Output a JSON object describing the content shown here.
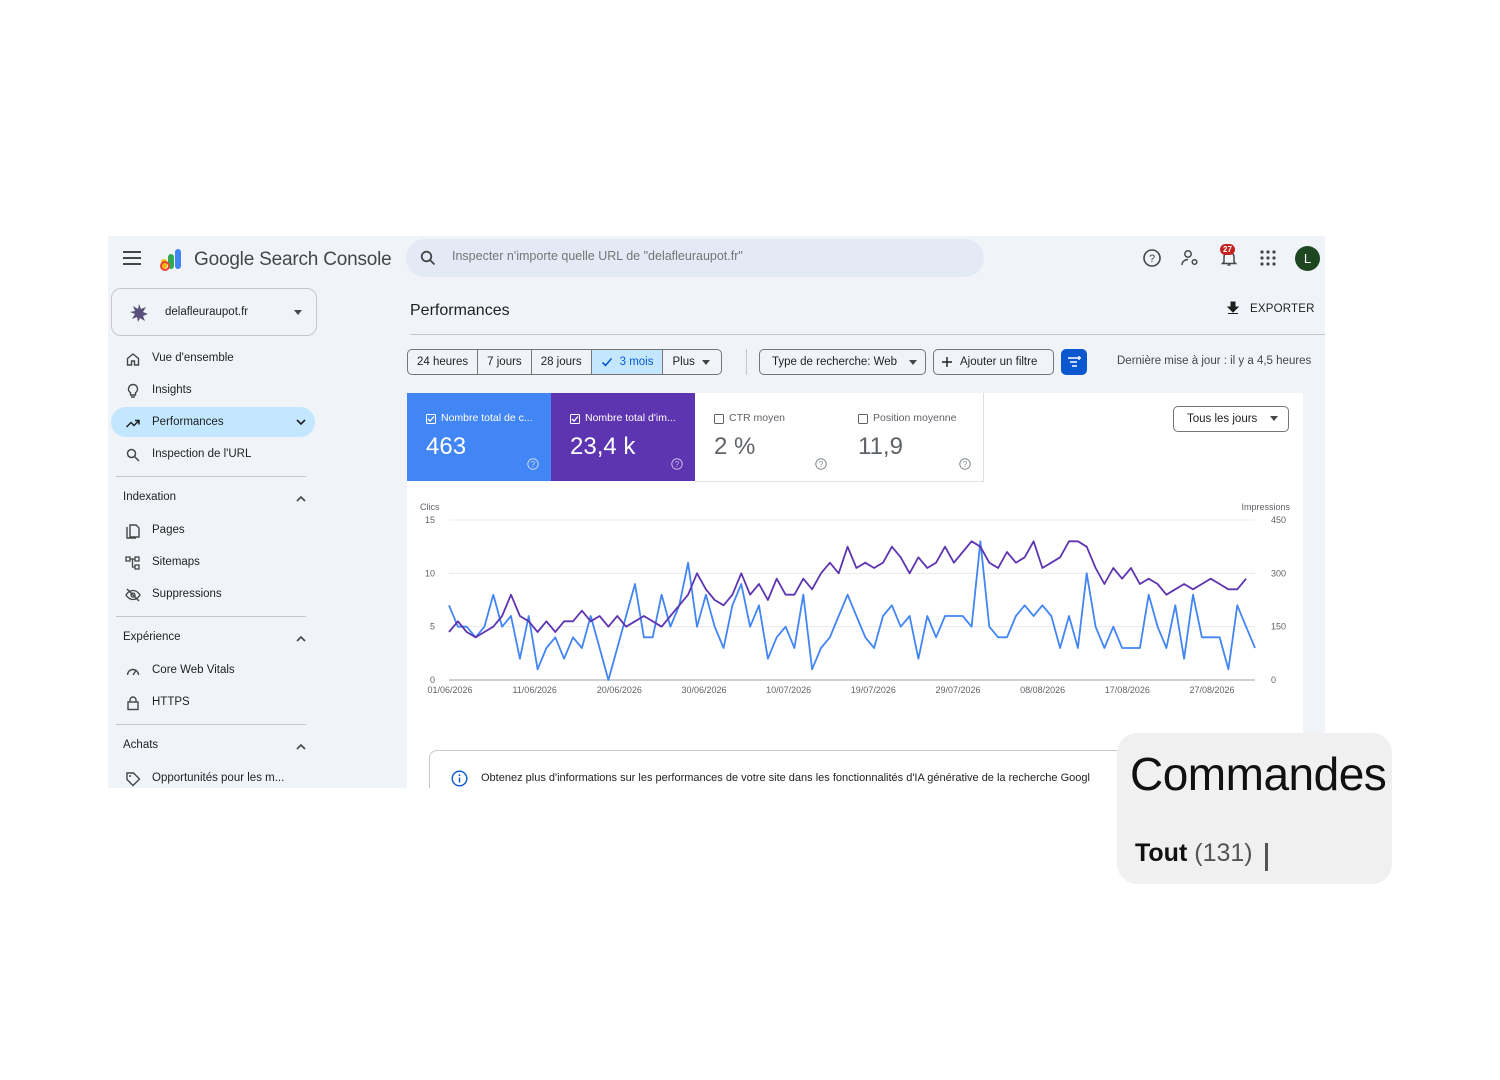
{
  "header": {
    "app_title": "Google Search Console",
    "search_placeholder": "Inspecter n'importe quelle URL de \"delafleuraupot.fr\"",
    "notification_count": "27",
    "avatar_letter": "L"
  },
  "property": {
    "name": "delafleuraupot.fr"
  },
  "sidebar": {
    "items": [
      {
        "label": "Vue d'ensemble",
        "icon": "home-icon"
      },
      {
        "label": "Insights",
        "icon": "lightbulb-icon"
      },
      {
        "label": "Performances",
        "icon": "trending-up-icon",
        "active": true
      },
      {
        "label": "Inspection de l'URL",
        "icon": "search-icon"
      }
    ],
    "sections": [
      {
        "title": "Indexation",
        "items": [
          {
            "label": "Pages",
            "icon": "pages-icon"
          },
          {
            "label": "Sitemaps",
            "icon": "sitemap-icon"
          },
          {
            "label": "Suppressions",
            "icon": "visibility-off-icon"
          }
        ]
      },
      {
        "title": "Expérience",
        "items": [
          {
            "label": "Core Web Vitals",
            "icon": "speed-icon"
          },
          {
            "label": "HTTPS",
            "icon": "lock-icon"
          }
        ]
      },
      {
        "title": "Achats",
        "items": [
          {
            "label": "Opportunités pour les m...",
            "icon": "tag-icon"
          }
        ]
      }
    ]
  },
  "main": {
    "title": "Performances",
    "export_label": "EXPORTER",
    "date_ranges": [
      "24 heures",
      "7 jours",
      "28 jours",
      "3 mois",
      "Plus"
    ],
    "selected_range": "3 mois",
    "search_type_label": "Type de recherche: Web",
    "add_filter_label": "Ajouter un filtre",
    "last_update": "Dernière mise à jour : il y a 4,5 heures",
    "metrics": [
      {
        "label": "Nombre total de c...",
        "value": "463",
        "checked": true,
        "color": "#4285f4"
      },
      {
        "label": "Nombre total d'im...",
        "value": "23,4 k",
        "checked": true,
        "color": "#5e35b1"
      },
      {
        "label": "CTR moyen",
        "value": "2 %",
        "checked": false
      },
      {
        "label": "Position moyenne",
        "value": "11,9",
        "checked": false
      }
    ],
    "days_dropdown": "Tous les jours",
    "info_text": "Obtenez plus d'informations sur les performances de votre site dans les fonctionnalités d'IA générative de la recherche Googl"
  },
  "chart_data": {
    "type": "line",
    "left_axis_label": "Clics",
    "right_axis_label": "Impressions",
    "left_ticks": [
      0,
      5,
      10,
      15
    ],
    "right_ticks": [
      0,
      150,
      300,
      450
    ],
    "ylim_left": [
      0,
      15
    ],
    "ylim_right": [
      0,
      450
    ],
    "x_ticks": [
      "01/06/2026",
      "11/06/2026",
      "20/06/2026",
      "30/06/2026",
      "10/07/2026",
      "19/07/2026",
      "29/07/2026",
      "08/08/2026",
      "17/08/2026",
      "27/08/2026"
    ],
    "grid": true,
    "series": [
      {
        "name": "Nombre total de c...",
        "axis": "left",
        "color": "#4285f4",
        "values": [
          7,
          5,
          5,
          4,
          5,
          8,
          5,
          6,
          2,
          6,
          1,
          3,
          4,
          2,
          4,
          3,
          6,
          3,
          0,
          3,
          6,
          9,
          4,
          4,
          8,
          5,
          7,
          11,
          5,
          8,
          5,
          3,
          7,
          9,
          5,
          7,
          2,
          4,
          5,
          3,
          8,
          1,
          3,
          4,
          6,
          8,
          6,
          4,
          3,
          6,
          7,
          5,
          6,
          2,
          6,
          4,
          6,
          6,
          6,
          5,
          13,
          5,
          4,
          4,
          6,
          7,
          6,
          7,
          6,
          3,
          6,
          3,
          10,
          5,
          3,
          5,
          3,
          3,
          3,
          8,
          5,
          3,
          7,
          2,
          8,
          4,
          4,
          4,
          1,
          7,
          5,
          3
        ]
      },
      {
        "name": "Nombre total d'im...",
        "axis": "left",
        "color": "#5e35b1",
        "values": [
          4.5,
          5.5,
          4.5,
          4,
          4.5,
          5,
          6,
          8,
          6,
          5.5,
          4.5,
          5.5,
          4.5,
          5.5,
          5.5,
          6.5,
          5.5,
          6,
          5,
          6,
          5,
          5.5,
          6,
          5.5,
          5,
          6,
          7,
          8,
          10,
          8.5,
          7.5,
          7,
          8,
          10,
          8,
          9,
          7.5,
          9.5,
          8,
          8,
          9.5,
          8.5,
          10,
          11,
          10,
          12.5,
          10.5,
          11,
          10.5,
          11,
          12.5,
          11.5,
          10,
          11.5,
          10.5,
          11,
          12.5,
          11,
          12,
          13,
          12.5,
          11,
          10.5,
          12,
          11,
          11.5,
          13,
          10.5,
          11,
          11.5,
          13,
          13,
          12.5,
          10.5,
          9,
          10.5,
          9.5,
          10.5,
          9,
          9.5,
          9,
          8,
          8.5,
          9,
          8.5,
          9,
          9.5,
          9,
          8.5,
          8.5,
          9.5
        ]
      }
    ]
  },
  "overlay": {
    "title": "Commandes",
    "tab_label": "Tout",
    "tab_count": "(131)"
  }
}
